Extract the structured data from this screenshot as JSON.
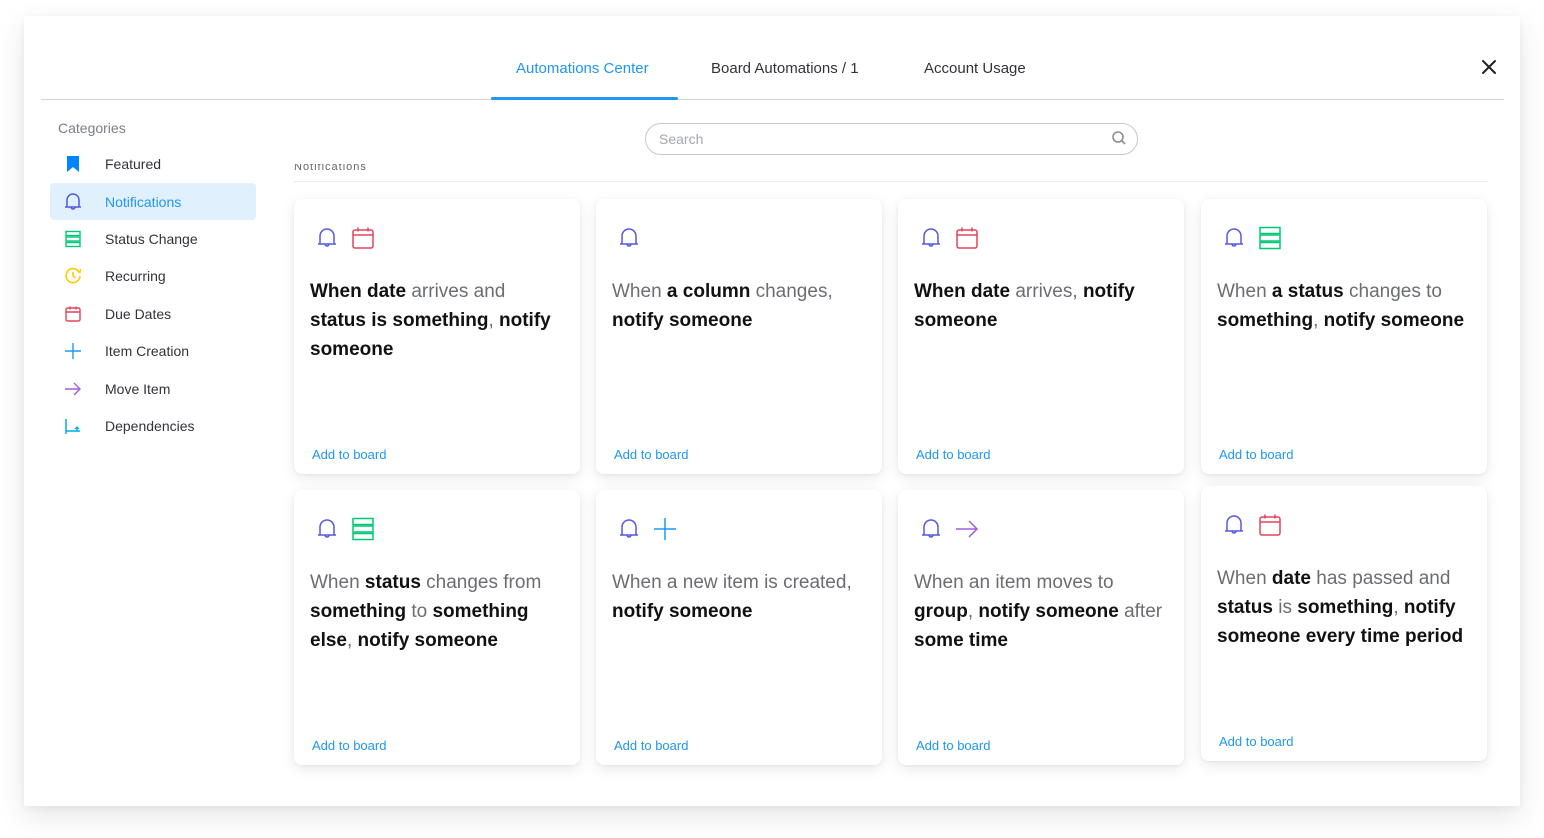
{
  "tabs": [
    {
      "label": "Automations Center",
      "active": true
    },
    {
      "label": "Board Automations / 1",
      "active": false
    },
    {
      "label": "Account Usage",
      "active": false
    }
  ],
  "sidebar": {
    "title": "Categories",
    "items": [
      {
        "label": "Featured",
        "icon": "bookmark-icon",
        "color": "#0085ff"
      },
      {
        "label": "Notifications",
        "icon": "bell-icon",
        "color": "#5559df",
        "active": true
      },
      {
        "label": "Status Change",
        "icon": "status-icon",
        "color": "#00c875"
      },
      {
        "label": "Recurring",
        "icon": "clock-icon",
        "color": "#ffcb00"
      },
      {
        "label": "Due Dates",
        "icon": "calendar-icon",
        "color": "#e2445c"
      },
      {
        "label": "Item Creation",
        "icon": "plus-icon",
        "color": "#2196f3"
      },
      {
        "label": "Move Item",
        "icon": "arrow-right-icon",
        "color": "#a25ddc"
      },
      {
        "label": "Dependencies",
        "icon": "dependency-icon",
        "color": "#00a9e6"
      }
    ]
  },
  "search": {
    "placeholder": "Search",
    "value": ""
  },
  "section_title": "Notifications",
  "cards": [
    {
      "icons": [
        "bell",
        "calendar"
      ],
      "parts": [
        [
          "b",
          "When"
        ],
        [
          "t",
          " "
        ],
        [
          "b",
          "date"
        ],
        [
          "t",
          " arrives and "
        ],
        [
          "b",
          "status"
        ],
        [
          "t",
          " "
        ],
        [
          "b",
          "is"
        ],
        [
          "t",
          " "
        ],
        [
          "b",
          "something"
        ],
        [
          "t",
          ", "
        ],
        [
          "b",
          "notify someone"
        ]
      ],
      "action": "Add to board"
    },
    {
      "icons": [
        "bell"
      ],
      "parts": [
        [
          "t",
          "When "
        ],
        [
          "b",
          "a column"
        ],
        [
          "t",
          " changes, "
        ],
        [
          "b",
          "notify someone"
        ]
      ],
      "action": "Add to board"
    },
    {
      "icons": [
        "bell",
        "calendar"
      ],
      "parts": [
        [
          "b",
          "When"
        ],
        [
          "t",
          " "
        ],
        [
          "b",
          "date"
        ],
        [
          "t",
          " arrives, "
        ],
        [
          "b",
          "notify someone"
        ]
      ],
      "action": "Add to board"
    },
    {
      "icons": [
        "bell",
        "status"
      ],
      "parts": [
        [
          "t",
          "When "
        ],
        [
          "b",
          "a status"
        ],
        [
          "t",
          " changes to "
        ],
        [
          "b",
          "something"
        ],
        [
          "t",
          ", "
        ],
        [
          "b",
          "notify someone"
        ]
      ],
      "action": "Add to board"
    },
    {
      "icons": [
        "bell",
        "status"
      ],
      "parts": [
        [
          "t",
          "When "
        ],
        [
          "b",
          "status"
        ],
        [
          "t",
          " changes from "
        ],
        [
          "b",
          "something"
        ],
        [
          "t",
          " to "
        ],
        [
          "b",
          "something else"
        ],
        [
          "t",
          ", "
        ],
        [
          "b",
          "notify someone"
        ]
      ],
      "action": "Add to board"
    },
    {
      "icons": [
        "bell",
        "plus"
      ],
      "parts": [
        [
          "t",
          "When a new item is created, "
        ],
        [
          "b",
          "notify someone"
        ]
      ],
      "action": "Add to board"
    },
    {
      "icons": [
        "bell",
        "arrow"
      ],
      "parts": [
        [
          "t",
          "When an item moves to "
        ],
        [
          "b",
          "group"
        ],
        [
          "t",
          ", "
        ],
        [
          "b",
          "notify someone"
        ],
        [
          "t",
          " after "
        ],
        [
          "b",
          "some time"
        ]
      ],
      "action": "Add to board"
    },
    {
      "icons": [
        "bell",
        "calendar"
      ],
      "parts": [
        [
          "t",
          "When "
        ],
        [
          "b",
          "date"
        ],
        [
          "t",
          " has passed and "
        ],
        [
          "b",
          "status"
        ],
        [
          "t",
          " is "
        ],
        [
          "b",
          "something"
        ],
        [
          "t",
          ", "
        ],
        [
          "b",
          "notify someone"
        ],
        [
          "t",
          " "
        ],
        [
          "b",
          "every time period"
        ]
      ],
      "action": "Add to board"
    }
  ],
  "colors": {
    "accent": "#2196f3",
    "bell": "#5559df",
    "calendar": "#e2445c",
    "status": "#00c875",
    "plus": "#2196f3",
    "arrow": "#a25ddc"
  }
}
